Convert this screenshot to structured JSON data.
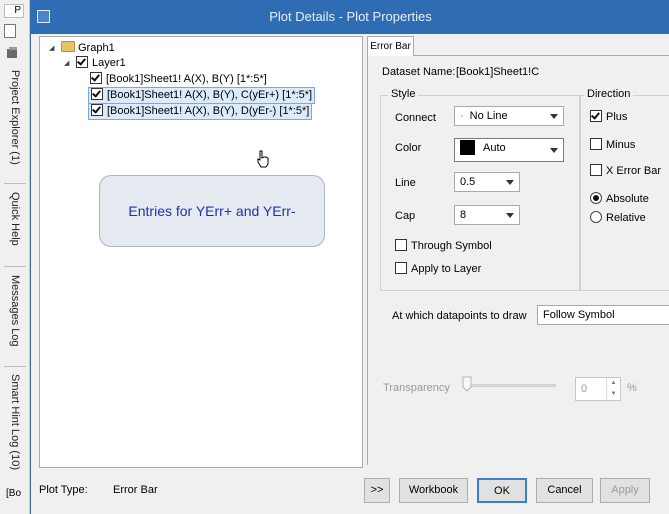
{
  "left_strip": {
    "top_icon_text": "P",
    "tabs": [
      "Project Explorer (1)",
      "Quick Help",
      "Messages Log",
      "Smart Hint Log (10)"
    ],
    "bottom_text": "[Bo"
  },
  "window": {
    "title": "Plot Details - Plot Properties"
  },
  "tree": {
    "graph": "Graph1",
    "layer": "Layer1",
    "items": [
      "[Book1]Sheet1! A(X), B(Y) [1*:5*]",
      "[Book1]Sheet1! A(X), B(Y), C(yEr+) [1*:5*]",
      "[Book1]Sheet1! A(X), B(Y), D(yEr-) [1*:5*]"
    ]
  },
  "callout": "Entries for YErr+ and YErr-",
  "plot_type": {
    "label": "Plot Type:",
    "value": "Error Bar"
  },
  "tab_label": "Error Bar",
  "dataset": {
    "label": "Dataset Name:",
    "value": "[Book1]Sheet1!C"
  },
  "style": {
    "title": "Style",
    "connect_label": "Connect",
    "connect_value": "No Line",
    "color_label": "Color",
    "color_value": "Auto",
    "color_swatch": "#000000",
    "line_label": "Line",
    "line_value": "0.5",
    "cap_label": "Cap",
    "cap_value": "8",
    "through_symbol": "Through Symbol",
    "apply_to_layer": "Apply to Layer"
  },
  "direction": {
    "title": "Direction",
    "plus": "Plus",
    "minus": "Minus",
    "x_error_bar": "X Error Bar",
    "absolute": "Absolute",
    "relative": "Relative"
  },
  "datapoints": {
    "label": "At which datapoints to draw",
    "value": "Follow Symbol"
  },
  "transparency": {
    "label": "Transparency",
    "value": "0",
    "unit": "%"
  },
  "buttons": {
    "more": ">>",
    "workbook": "Workbook",
    "ok": "OK",
    "cancel": "Cancel",
    "apply": "Apply"
  }
}
